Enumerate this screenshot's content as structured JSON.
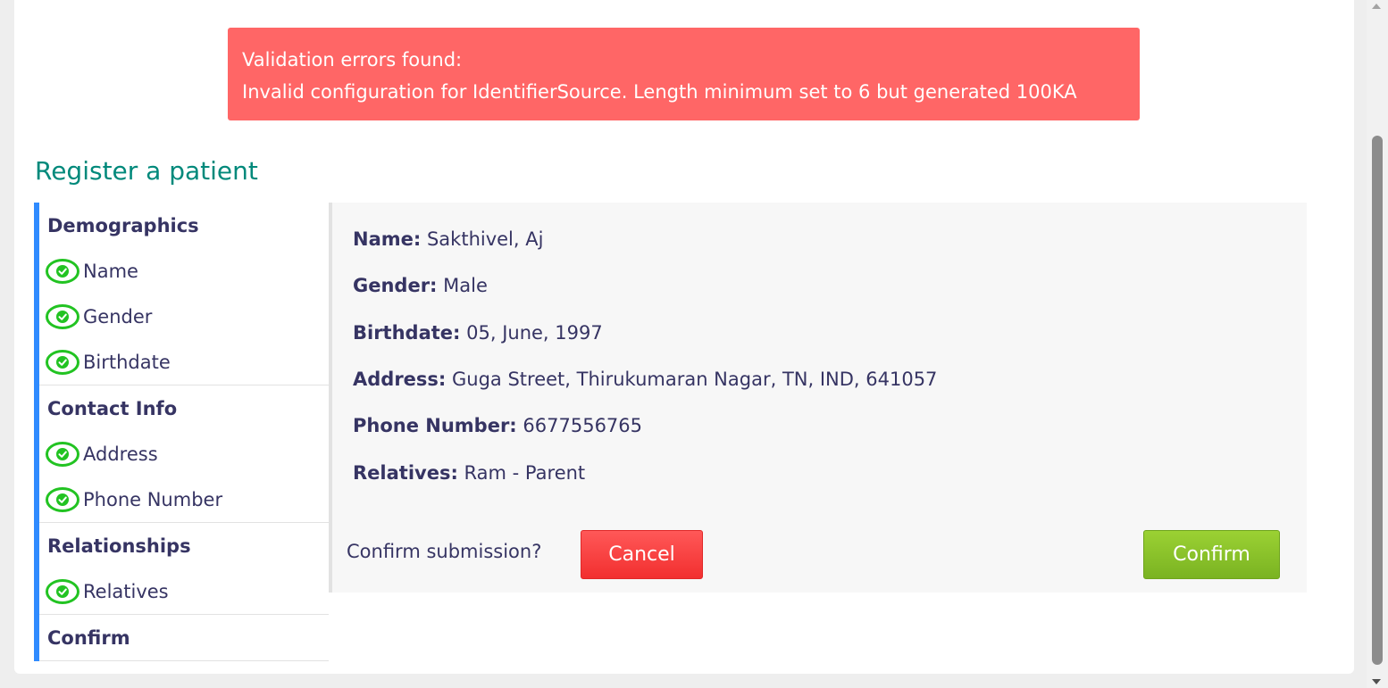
{
  "alert": {
    "heading": "Validation errors found:",
    "message": "Invalid configuration for IdentifierSource. Length minimum set to 6 but generated 100KA"
  },
  "page": {
    "title": "Register a patient"
  },
  "sidebar": {
    "sections": [
      {
        "title": "Demographics",
        "items": [
          {
            "label": "Name",
            "status": "complete"
          },
          {
            "label": "Gender",
            "status": "complete"
          },
          {
            "label": "Birthdate",
            "status": "complete"
          }
        ]
      },
      {
        "title": "Contact Info",
        "items": [
          {
            "label": "Address",
            "status": "complete"
          },
          {
            "label": "Phone Number",
            "status": "complete"
          }
        ]
      },
      {
        "title": "Relationships",
        "items": [
          {
            "label": "Relatives",
            "status": "complete"
          }
        ]
      },
      {
        "title": "Confirm",
        "items": []
      }
    ]
  },
  "summary": {
    "rows": [
      {
        "label": "Name:",
        "value": "Sakthivel, Aj"
      },
      {
        "label": "Gender:",
        "value": "Male"
      },
      {
        "label": "Birthdate:",
        "value": "05, June, 1997"
      },
      {
        "label": "Address:",
        "value": "Guga Street, Thirukumaran Nagar, TN, IND, 641057"
      },
      {
        "label": "Phone Number:",
        "value": "6677556765"
      },
      {
        "label": "Relatives:",
        "value": "Ram - Parent"
      }
    ],
    "question": "Confirm submission?",
    "cancel_label": "Cancel",
    "confirm_label": "Confirm"
  },
  "colors": {
    "alert_bg": "#ff6666",
    "title": "#00897b",
    "nav_accent": "#2f8bff",
    "check": "#22c322",
    "cancel": "#f33b3b",
    "confirm": "#88c02a",
    "text": "#363463"
  },
  "icons": {
    "check": "check-circle-icon"
  }
}
